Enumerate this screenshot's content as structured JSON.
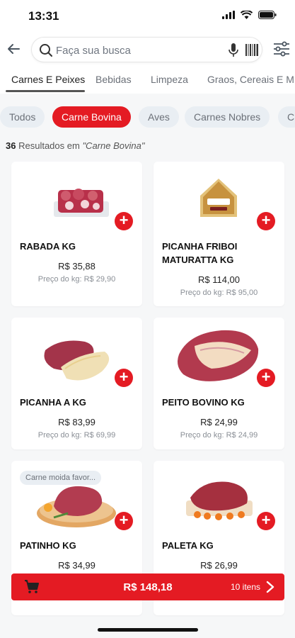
{
  "status": {
    "time": "13:31"
  },
  "search": {
    "placeholder": "Faça sua busca"
  },
  "categories": [
    {
      "label": "Carnes E Peixes",
      "active": true
    },
    {
      "label": "Bebidas",
      "active": false
    },
    {
      "label": "Limpeza",
      "active": false
    },
    {
      "label": "Graos, Cereais E M",
      "active": false
    }
  ],
  "subcategories": [
    {
      "label": "Todos",
      "active": false
    },
    {
      "label": "Carne Bovina",
      "active": true
    },
    {
      "label": "Aves",
      "active": false
    },
    {
      "label": "Carnes Nobres",
      "active": false
    },
    {
      "label": "C",
      "active": false
    }
  ],
  "results": {
    "count": "36",
    "text": "Resultados em",
    "query": "\"Carne Bovina\""
  },
  "products": [
    {
      "name": "RABADA KG",
      "price": "R$ 35,88",
      "per_kg": "Preço do kg: R$ 29,90",
      "tag": ""
    },
    {
      "name": "PICANHA FRIBOI MATURATTA KG",
      "price": "R$ 114,00",
      "per_kg": "Preço do kg: R$ 95,00",
      "tag": ""
    },
    {
      "name": "PICANHA A KG",
      "price": "R$ 83,99",
      "per_kg": "Preço do kg: R$ 69,99",
      "tag": ""
    },
    {
      "name": "PEITO BOVINO KG",
      "price": "R$ 24,99",
      "per_kg": "Preço do kg: R$ 24,99",
      "tag": ""
    },
    {
      "name": "PATINHO KG",
      "price": "R$ 34,99",
      "per_kg": "",
      "tag": "Carne moida favor..."
    },
    {
      "name": "PALETA KG",
      "price": "R$ 26,99",
      "per_kg": "",
      "tag": ""
    }
  ],
  "cart": {
    "total": "R$ 148,18",
    "items": "10 itens"
  },
  "colors": {
    "accent": "#e41b23",
    "chip_bg": "#e9eef3",
    "background": "#f6f7f8"
  }
}
